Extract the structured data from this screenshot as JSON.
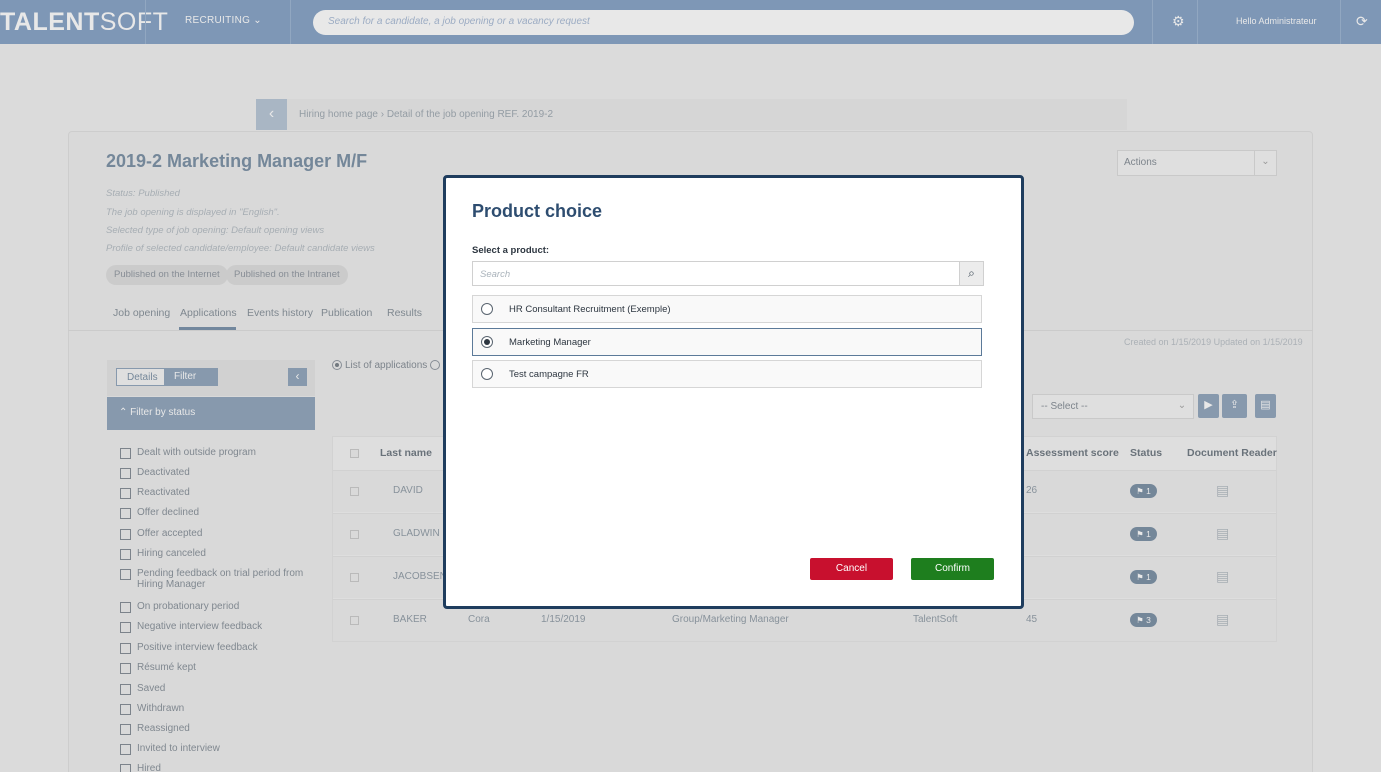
{
  "topbar": {
    "logo_bold": "TALENT",
    "logo_light": "SOFT",
    "recruiting": "RECRUITING ⌄",
    "search_placeholder": "Search for a candidate, a job opening or a vacancy request",
    "hello": "Hello Administrateur"
  },
  "breadcrumb": {
    "text": "Hiring home page  ›  Detail of the job opening REF. 2019-2"
  },
  "job": {
    "title": "2019-2 Marketing Manager M/F",
    "meta": [
      "Status: Published",
      "The job opening is displayed in \"English\".",
      "Selected type of job opening: Default opening views",
      "Profile of selected candidate/employee: Default candidate views"
    ],
    "pills": [
      "Published on the Internet",
      "Published on the Intranet"
    ],
    "tabs": [
      "Job opening",
      "Applications",
      "Events history",
      "Publication",
      "Results"
    ],
    "actions": "Actions",
    "created": "Created on 1/15/2019 Updated on 1/15/2019"
  },
  "sidebar": {
    "tab_details": "Details",
    "tab_filter": "Filter",
    "filter_header": "Filter by status",
    "statuses": [
      "Dealt with outside program",
      "Deactivated",
      "Reactivated",
      "Offer declined",
      "Offer accepted",
      "Hiring canceled",
      "Pending feedback on trial period from Hiring Manager",
      "On probationary period",
      "Negative interview feedback",
      "Positive interview feedback",
      "Résumé kept",
      "Saved",
      "Withdrawn",
      "Reassigned",
      "Invited to interview",
      "Hired"
    ]
  },
  "list": {
    "view_option": "List of applications",
    "select_placeholder": "-- Select --",
    "columns": [
      "Last name",
      "Assessment score",
      "Status",
      "Document Reader"
    ],
    "rows": [
      {
        "last": "DAVID",
        "first": "",
        "date": "",
        "origin": "",
        "source": "",
        "score": "26",
        "status": "1"
      },
      {
        "last": "GLADWIN",
        "first": "",
        "date": "",
        "origin": "",
        "source": "",
        "score": "",
        "status": "1"
      },
      {
        "last": "JACOBSEN",
        "first": "",
        "date": "",
        "origin": "",
        "source": "",
        "score": "",
        "status": "1"
      },
      {
        "last": "BAKER",
        "first": "Cora",
        "date": "1/15/2019",
        "origin": "Group/Marketing Manager",
        "source": "TalentSoft",
        "score": "45",
        "status": "3"
      }
    ]
  },
  "modal": {
    "title": "Product choice",
    "label": "Select a product:",
    "search_placeholder": "Search",
    "products": [
      "HR Consultant Recruitment (Exemple)",
      "Marketing Manager",
      "Test campagne FR"
    ],
    "selected_index": 1,
    "cancel": "Cancel",
    "confirm": "Confirm"
  }
}
